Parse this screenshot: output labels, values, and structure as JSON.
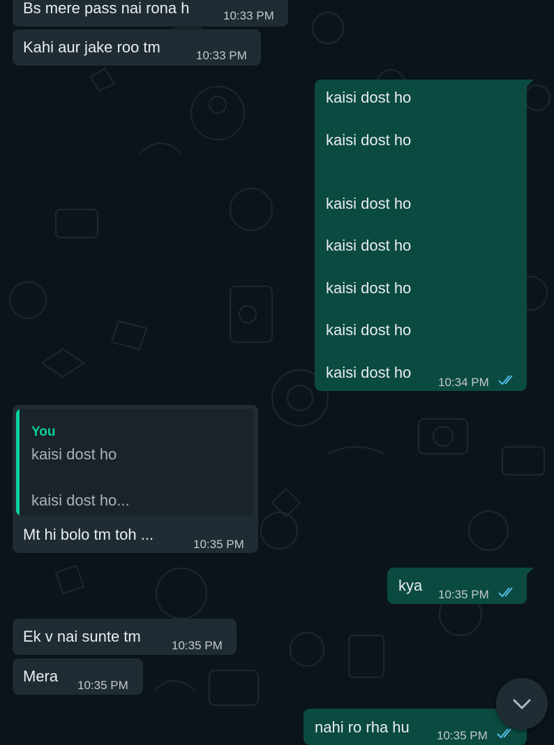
{
  "messages": {
    "m1": {
      "text": "Bs mere pass nai rona h",
      "time": "10:33 PM"
    },
    "m2": {
      "text": "Kahi aur jake roo tm",
      "time": "10:33 PM"
    },
    "m3": {
      "lines": [
        "kaisi dost ho",
        "kaisi dost ho",
        "kaisi dost ho",
        "kaisi dost ho",
        "kaisi dost ho",
        "kaisi dost ho",
        "kaisi dost ho"
      ],
      "time": "10:34 PM",
      "status": "read"
    },
    "m4": {
      "quote": {
        "author": "You",
        "line1": "kaisi dost ho",
        "line2": "kaisi dost ho..."
      },
      "text": "Mt hi bolo tm toh ...",
      "time": "10:35 PM"
    },
    "m5": {
      "text": "kya",
      "time": "10:35 PM",
      "status": "read"
    },
    "m6": {
      "text": "Ek v nai sunte tm",
      "time": "10:35 PM"
    },
    "m7": {
      "text": "Mera",
      "time": "10:35 PM"
    },
    "m8": {
      "text": "nahi ro rha hu",
      "time": "10:35 PM",
      "status": "read"
    }
  },
  "icons": {
    "read_ticks": "double-check-icon",
    "scroll_down": "chevron-down-icon"
  },
  "colors": {
    "background": "#0b141a",
    "incoming": "#202c33",
    "outgoing": "#0b4a40",
    "accent": "#06cf9c",
    "read_ticks": "#53bdeb"
  }
}
